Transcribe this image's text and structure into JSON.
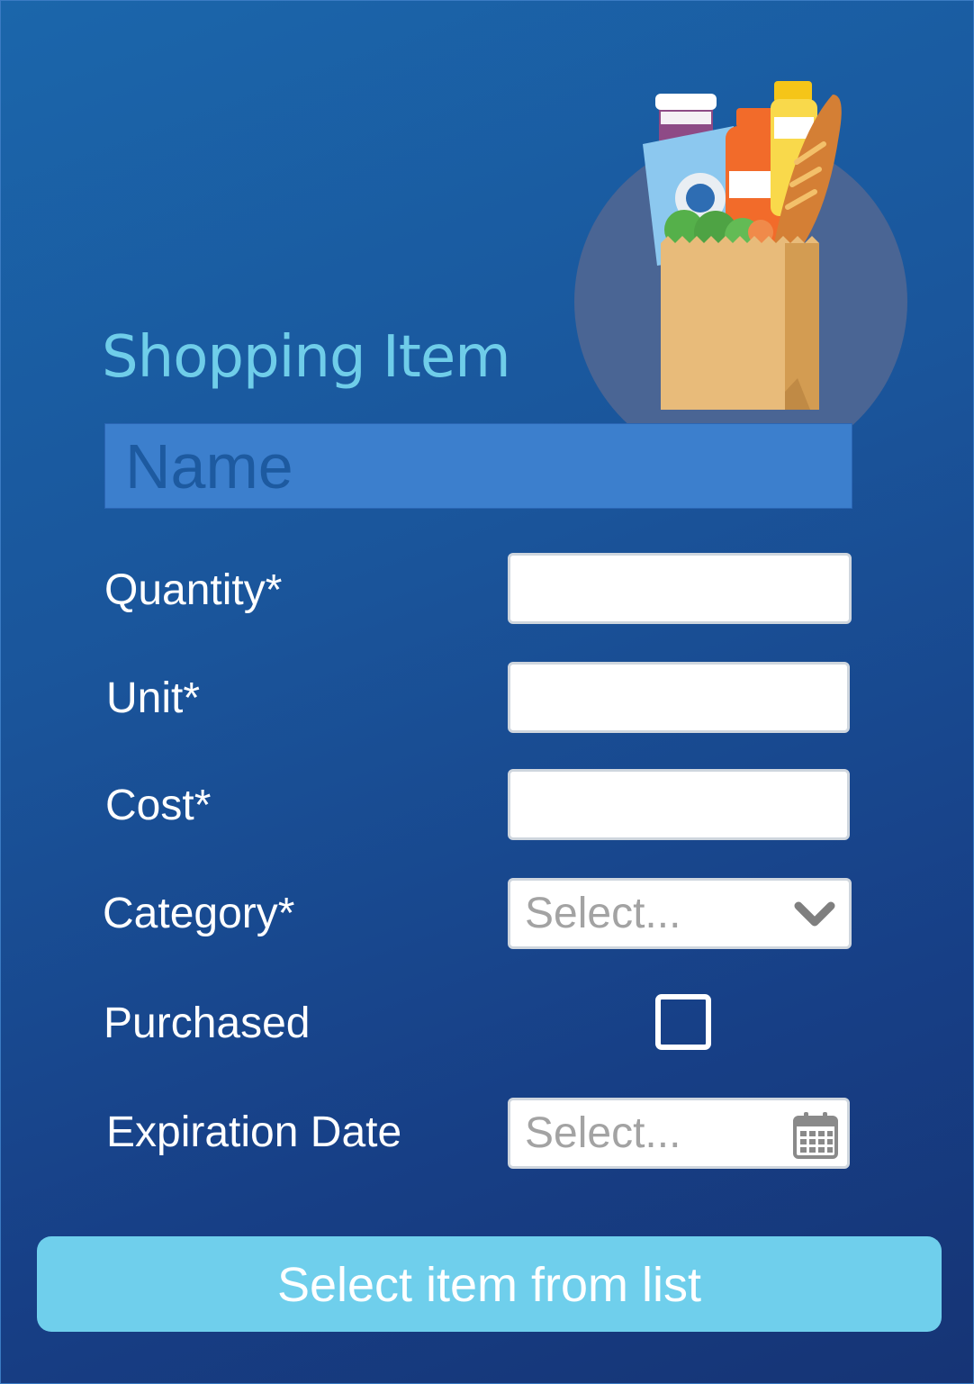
{
  "form": {
    "title": "Shopping Item",
    "name_placeholder": "Name",
    "fields": {
      "quantity_label": "Quantity*",
      "unit_label": "Unit*",
      "cost_label": "Cost*",
      "category_label": "Category*",
      "category_value": "Select...",
      "purchased_label": "Purchased",
      "purchased_checked": false,
      "expiration_label": "Expiration Date",
      "expiration_value": "Select..."
    },
    "submit_label": "Select item from list"
  },
  "icons": {
    "hero": "grocery-bag-icon",
    "category_dropdown": "chevron-down-icon",
    "expiration_picker": "calendar-icon"
  },
  "colors": {
    "background": "#1a559b",
    "title": "#6fcde9",
    "name_field": "#3c7fcd",
    "button": "#6fcfec",
    "text": "#ffffff"
  }
}
